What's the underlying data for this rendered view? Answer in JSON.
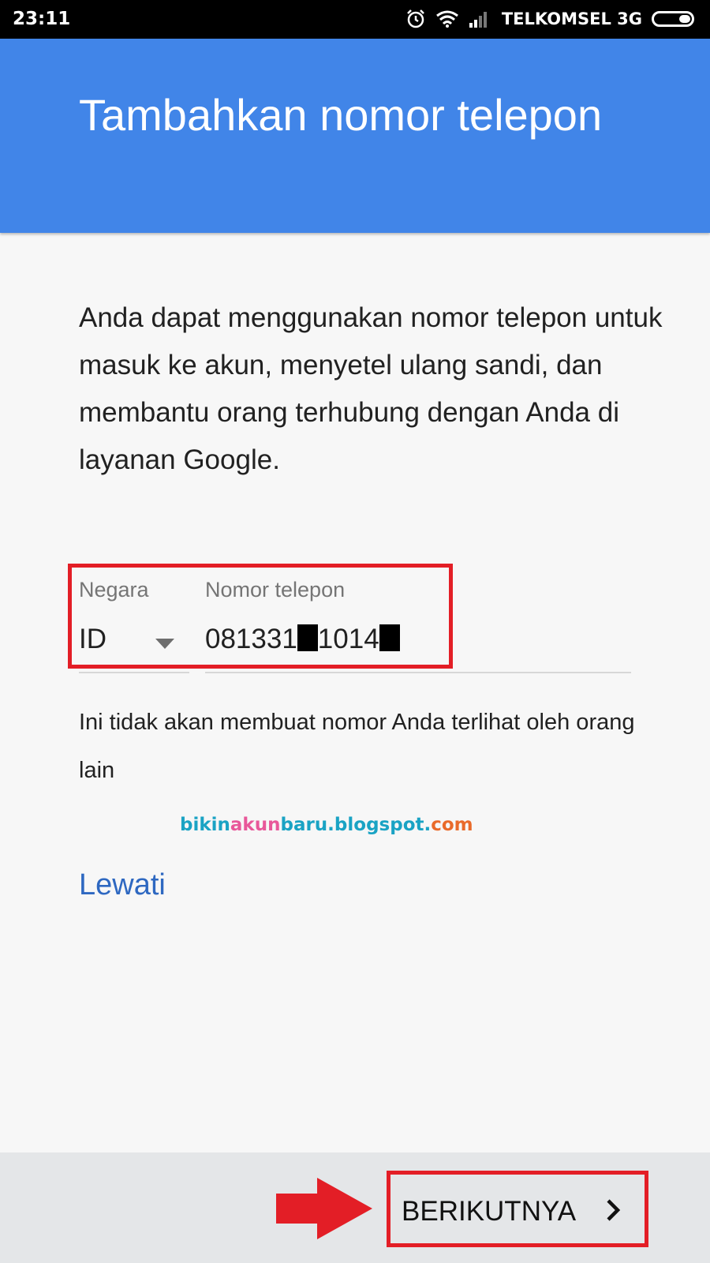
{
  "status_bar": {
    "time": "23:11",
    "carrier": "TELKOMSEL 3G"
  },
  "header": {
    "title": "Tambahkan nomor telepon"
  },
  "description": "Anda dapat menggunakan nomor telepon untuk masuk ke akun, menyetel ulang sandi, dan membantu orang terhubung dengan Anda di layanan Google.",
  "country_field": {
    "label": "Negara",
    "value": "ID"
  },
  "phone_field": {
    "label": "Nomor telepon",
    "value_part1": "081331",
    "value_part2": "1014"
  },
  "privacy_note": "Ini tidak akan membuat nomor Anda terlihat oleh orang lain",
  "watermark": {
    "part1": "bikin",
    "part2": "akun",
    "part3": "baru.blogspot.",
    "part4": "com"
  },
  "skip_link": "Lewati",
  "next_button": "BERIKUTNYA",
  "colors": {
    "header": "#4185e8",
    "link": "#2e68c1",
    "highlight": "#e31e26"
  }
}
